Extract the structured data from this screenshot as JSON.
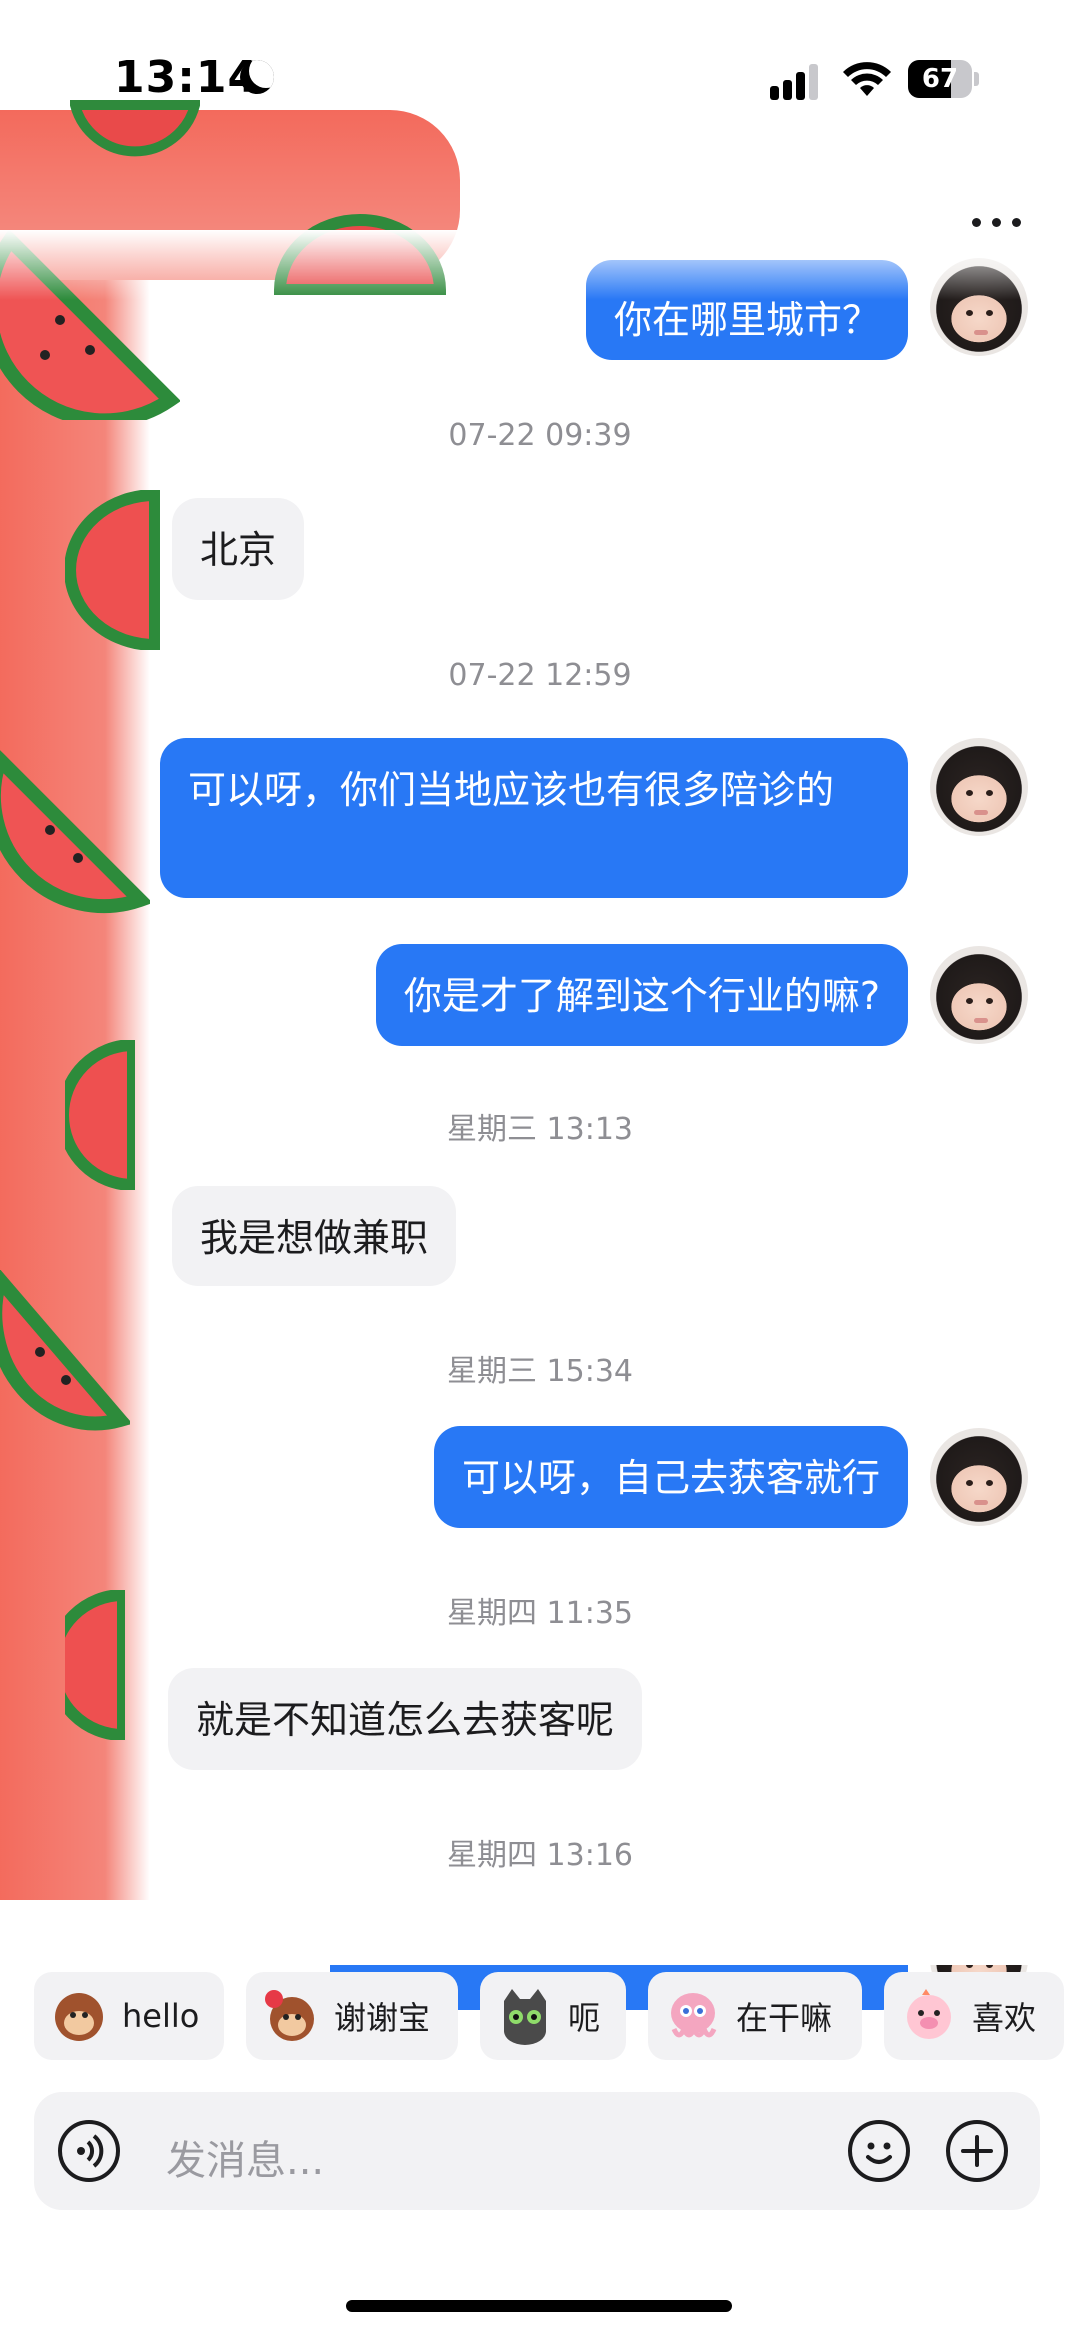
{
  "status_bar": {
    "time": "13:14",
    "battery": "67",
    "battery_level": 0.67
  },
  "header": {
    "more_icon": "more-horizontal-icon"
  },
  "messages": [
    {
      "type": "outgoing",
      "text": "你在哪里城市？"
    },
    {
      "type": "timestamp",
      "text": "07-22 09:39"
    },
    {
      "type": "incoming",
      "text": "北京"
    },
    {
      "type": "timestamp",
      "text": "07-22 12:59"
    },
    {
      "type": "outgoing",
      "text": "可以呀，你们当地应该也有很多陪诊的"
    },
    {
      "type": "outgoing",
      "text": "你是才了解到这个行业的嘛?"
    },
    {
      "type": "timestamp",
      "text": "星期三 13:13"
    },
    {
      "type": "incoming",
      "text": "我是想做兼职"
    },
    {
      "type": "timestamp",
      "text": "星期三 15:34"
    },
    {
      "type": "outgoing",
      "text": "可以呀，自己去获客就行"
    },
    {
      "type": "timestamp",
      "text": "星期四 11:35"
    },
    {
      "type": "incoming",
      "text": "就是不知道怎么去获客呢"
    },
    {
      "type": "timestamp",
      "text": "星期四 13:16"
    }
  ],
  "quick_replies": [
    {
      "label": "hello",
      "icon": "monkey-sticker-icon"
    },
    {
      "label": "谢谢宝",
      "icon": "monkey-flower-sticker-icon"
    },
    {
      "label": "呃",
      "icon": "cat-sticker-icon"
    },
    {
      "label": "在干嘛",
      "icon": "octopus-sticker-icon"
    },
    {
      "label": "喜欢",
      "icon": "pig-sticker-icon"
    }
  ],
  "input": {
    "placeholder": "发消息..."
  },
  "colors": {
    "outgoing_bubble": "#2878f5",
    "incoming_bubble": "#f2f2f4",
    "timestamp_text": "#8e8e93"
  }
}
